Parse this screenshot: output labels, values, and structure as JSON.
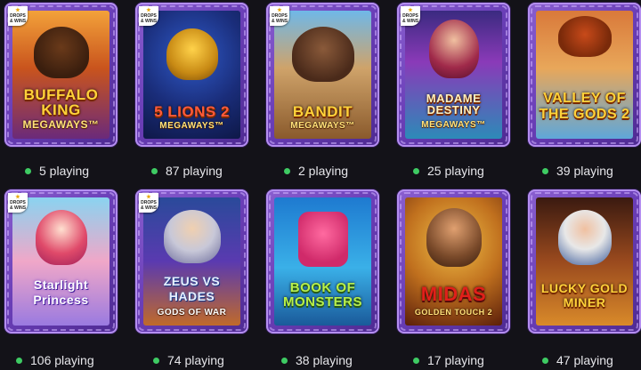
{
  "games": [
    {
      "title_line1": "Buffalo King",
      "title_line2": "MEGAWAYS™",
      "players": "5 playing",
      "badge": "DROPS & WINS",
      "theme": "buffalo-icon"
    },
    {
      "title_line1": "5 Lions 2",
      "title_line2": "MEGAWAYS™",
      "players": "87 playing",
      "badge": "DROPS & WINS",
      "theme": "lion-icon"
    },
    {
      "title_line1": "Bandit",
      "title_line2": "MEGAWAYS™",
      "players": "2 playing",
      "badge": "DROPS & WINS",
      "theme": "cowboy-icon"
    },
    {
      "title_line1": "Madame Destiny",
      "title_line2": "MEGAWAYS™",
      "players": "25 playing",
      "badge": "DROPS & WINS",
      "theme": "fortune-teller-icon"
    },
    {
      "title_line1": "Valley of the Gods 2",
      "title_line2": "",
      "players": "39 playing",
      "badge": "",
      "theme": "pharaoh-icon"
    },
    {
      "title_line1": "Starlight Princess",
      "title_line2": "",
      "players": "106 playing",
      "badge": "DROPS & WINS",
      "theme": "princess-icon"
    },
    {
      "title_line1": "Zeus vs Hades",
      "title_line2": "GODS OF WAR",
      "players": "74 playing",
      "badge": "DROPS & WINS",
      "theme": "zeus-icon"
    },
    {
      "title_line1": "Book of Monsters",
      "title_line2": "",
      "players": "38 playing",
      "badge": "",
      "theme": "monster-icon"
    },
    {
      "title_line1": "Midas",
      "title_line2": "GOLDEN TOUCH 2",
      "players": "17 playing",
      "badge": "",
      "theme": "king-icon"
    },
    {
      "title_line1": "Lucky Gold Miner",
      "title_line2": "",
      "players": "47 playing",
      "badge": "",
      "theme": "miner-icon"
    }
  ],
  "colors": {
    "background": "#131218",
    "frame": "#7a4fc4",
    "online_dot": "#3ecb63",
    "status_text": "#e6e6ea"
  }
}
